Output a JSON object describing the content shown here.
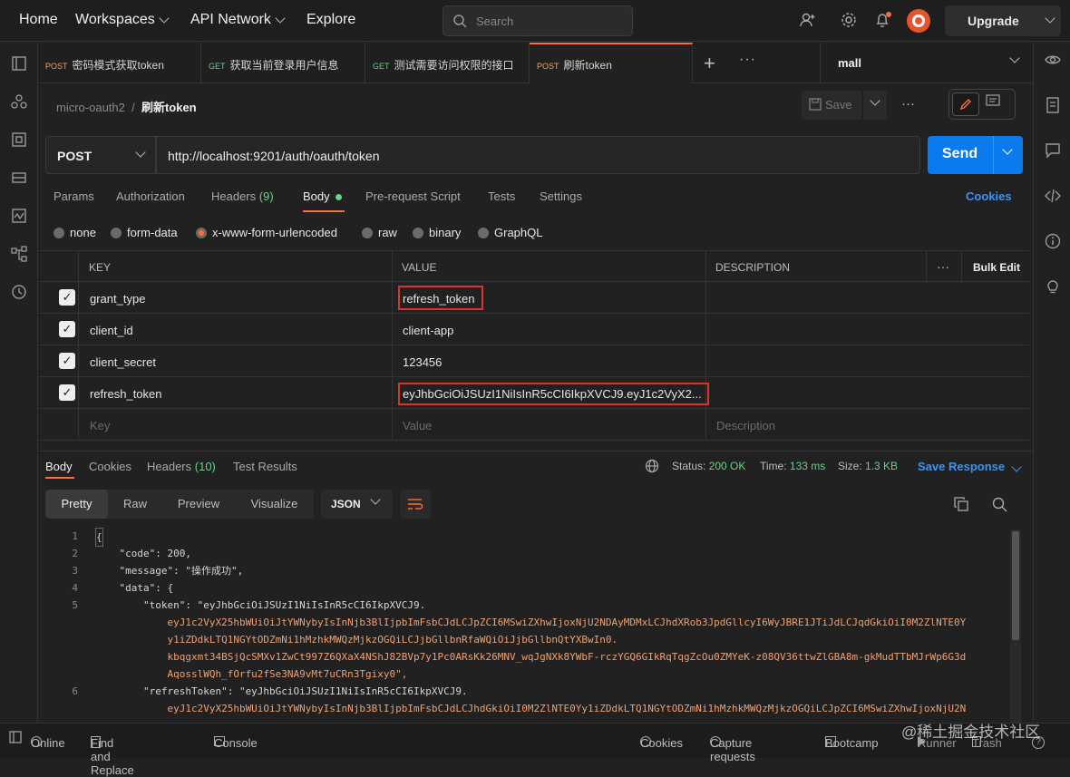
{
  "topnav": {
    "home": "Home",
    "workspaces": "Workspaces",
    "api_network": "API Network",
    "explore": "Explore",
    "search_placeholder": "Search",
    "upgrade": "Upgrade"
  },
  "tabs": [
    {
      "method": "POST",
      "title": "密码模式获取token",
      "active": false
    },
    {
      "method": "GET",
      "title": "获取当前登录用户信息",
      "active": false
    },
    {
      "method": "GET",
      "title": "测试需要访问权限的接口",
      "active": false
    },
    {
      "method": "POST",
      "title": "刷新token",
      "active": true
    }
  ],
  "environment": "mall",
  "breadcrumb": {
    "collection": "micro-oauth2",
    "request": "刷新token"
  },
  "save_label": "Save",
  "request": {
    "method": "POST",
    "url": "http://localhost:9201/auth/oauth/token",
    "send_label": "Send"
  },
  "request_tabs": {
    "params": "Params",
    "authorization": "Authorization",
    "headers": "Headers",
    "headers_count": "(9)",
    "body": "Body",
    "prerequest": "Pre-request Script",
    "tests": "Tests",
    "settings": "Settings",
    "cookies": "Cookies"
  },
  "body_types": [
    "none",
    "form-data",
    "x-www-form-urlencoded",
    "raw",
    "binary",
    "GraphQL"
  ],
  "body_selected": "x-www-form-urlencoded",
  "table": {
    "headers": {
      "key": "KEY",
      "value": "VALUE",
      "description": "DESCRIPTION",
      "bulk_edit": "Bulk Edit"
    },
    "rows": [
      {
        "key": "grant_type",
        "value": "refresh_token"
      },
      {
        "key": "client_id",
        "value": "client-app"
      },
      {
        "key": "client_secret",
        "value": "123456"
      },
      {
        "key": "refresh_token",
        "value": "eyJhbGciOiJSUzI1NiIsInR5cCI6IkpXVCJ9.eyJ1c2VyX2..."
      }
    ],
    "placeholder": {
      "key": "Key",
      "value": "Value",
      "description": "Description"
    }
  },
  "response": {
    "tabs": {
      "body": "Body",
      "cookies": "Cookies",
      "headers": "Headers",
      "headers_count": "(10)",
      "test_results": "Test Results"
    },
    "status_label": "Status:",
    "status": "200 OK",
    "time_label": "Time:",
    "time": "133 ms",
    "size_label": "Size:",
    "size": "1.3 KB",
    "save_response": "Save Response",
    "formats": [
      "Pretty",
      "Raw",
      "Preview",
      "Visualize"
    ],
    "format_type": "JSON",
    "lines": [
      {
        "n": "1",
        "text": "{"
      },
      {
        "n": "2",
        "text": "    \"code\": 200,"
      },
      {
        "n": "3",
        "text": "    \"message\": \"操作成功\","
      },
      {
        "n": "4",
        "text": "    \"data\": {"
      },
      {
        "n": "5",
        "text": "        \"token\": \"eyJhbGciOiJSUzI1NiIsInR5cCI6IkpXVCJ9."
      },
      {
        "n": "",
        "text": "            eyJ1c2VyX25hbWUiOiJtYWNybyIsInNjb3BlIjpbImFsbCJdLCJpZCI6MSwiZXhwIjoxNjU2NDAyMDMxLCJhdXRob3JpdGllcyI6WyJBRE1JTiJdLCJqdGkiOiI0M2ZlNTE0Y"
      },
      {
        "n": "",
        "text": "            y1iZDdkLTQ1NGYtODZmNi1hMzhkMWQzMjkzOGQiLCJjbGllbnRfaWQiOiJjbGllbnQtYXBwIn0."
      },
      {
        "n": "",
        "text": "            kbqgxmt34BSjQcSMXv1ZwCt997Z6QXaX4NShJ82BVp7y1Pc0ARsKk26MNV_wqJgNXk8YWbF-rczYGQ6GIkRqTqgZcOu0ZMYeK-z08QV36ttwZlGBA8m-gkMudTTbMJrWp6G3d"
      },
      {
        "n": "",
        "text": "            AqosslWQh_fOrfu2fSe3NA9vMt7uCRn3Tgixy0\","
      },
      {
        "n": "6",
        "text": "        \"refreshToken\": \"eyJhbGciOiJSUzI1NiIsInR5cCI6IkpXVCJ9."
      },
      {
        "n": "",
        "text": "            eyJ1c2VyX25hbWUiOiJtYWNybyIsInNjb3BlIjpbImFsbCJdLCJhdGkiOiI0M2ZlNTE0Yy1iZDdkLTQ1NGYtODZmNi1hMzhkMWQzMjkzOGQiLCJpZCI6MSwiZXhwIjoxNjU2N"
      }
    ]
  },
  "statusbar": {
    "online": "Online",
    "find_replace": "Find and Replace",
    "console": "Console",
    "cookies": "Cookies",
    "capture": "Capture requests",
    "bootcamp": "Bootcamp",
    "runner": "Runner",
    "trash": "Trash",
    "watermark": "@稀土掘金技术社区"
  },
  "colors": {
    "accent": "#ff6c37",
    "send": "#097bed",
    "highlight": "#e0302a",
    "status_ok": "#6bd089"
  }
}
